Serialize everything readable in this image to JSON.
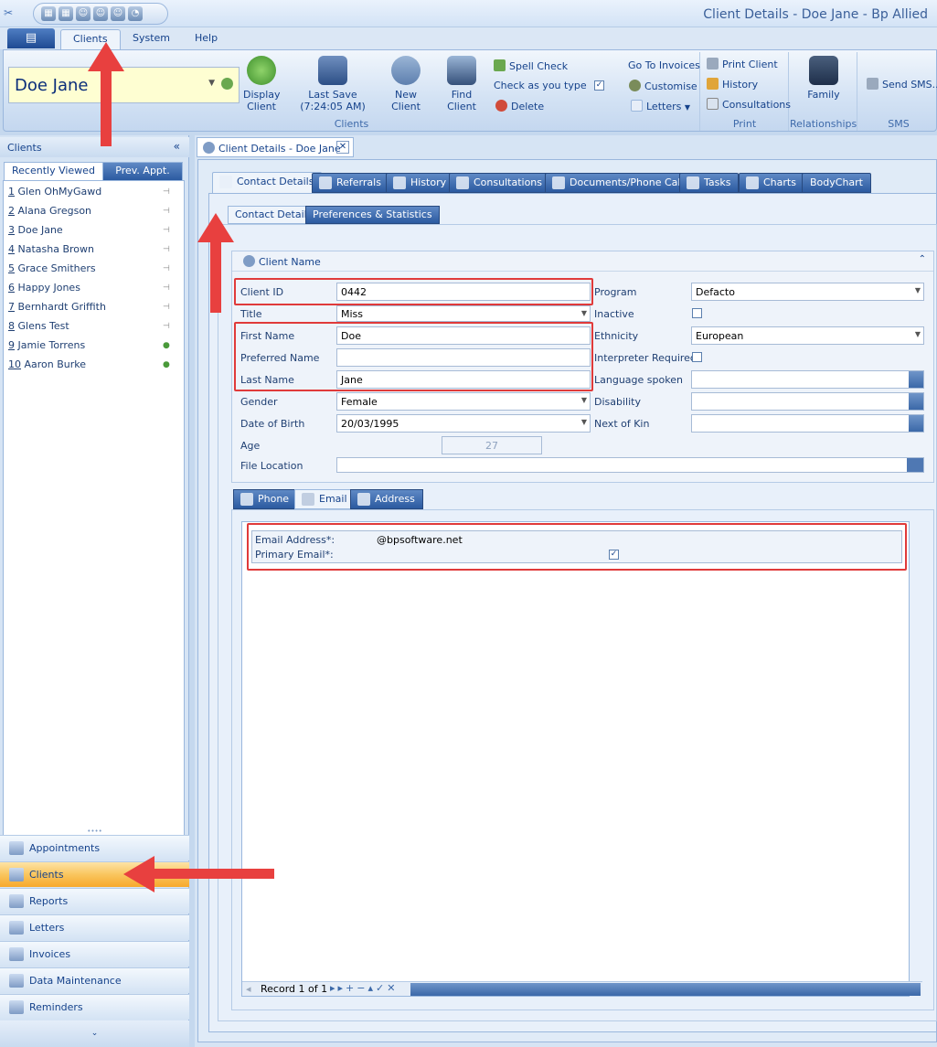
{
  "window": {
    "title": "Client Details - Doe Jane - Bp Allied"
  },
  "ribbon_tabs": [
    "Clients",
    "System",
    "Help"
  ],
  "client_selector": {
    "value": "Doe Jane"
  },
  "ribbon": {
    "display_client": "Display Client",
    "last_save": "Last Save",
    "last_save_time": "(7:24:05 AM)",
    "new_client": "New Client",
    "find_client": "Find Client",
    "spell_check": "Spell Check",
    "check_as_you_type": "Check as you type",
    "delete": "Delete",
    "go_to_invoices": "Go To Invoices",
    "customise": "Customise",
    "letters": "Letters",
    "print_client": "Print Client",
    "history": "History",
    "consultations": "Consultations",
    "family": "Family",
    "send_sms": "Send SMS...",
    "group_clients": "Clients",
    "group_print": "Print",
    "group_relationships": "Relationships",
    "group_sms": "SMS"
  },
  "left_panel": {
    "title": "Clients",
    "tabs": [
      "Recently Viewed",
      "Prev. Appt."
    ],
    "clients": [
      {
        "num": "1",
        "name": "Glen OhMyGawd"
      },
      {
        "num": "2",
        "name": "Alana Gregson"
      },
      {
        "num": "3",
        "name": "Doe Jane"
      },
      {
        "num": "4",
        "name": "Natasha Brown"
      },
      {
        "num": "5",
        "name": "Grace Smithers"
      },
      {
        "num": "6",
        "name": "Happy Jones"
      },
      {
        "num": "7",
        "name": "Bernhardt Griffith"
      },
      {
        "num": "8",
        "name": "Glens Test"
      },
      {
        "num": "9",
        "name": "Jamie Torrens"
      },
      {
        "num": "10",
        "name": "Aaron Burke"
      }
    ],
    "nav": [
      "Appointments",
      "Clients",
      "Reports",
      "Letters",
      "Invoices",
      "Data Maintenance",
      "Reminders"
    ]
  },
  "doc_tab": {
    "title": "Client Details - Doe Jane"
  },
  "content_tabs": [
    "Contact Details",
    "Referrals",
    "History",
    "Consultations",
    "Documents/Phone Calls",
    "Tasks",
    "Charts",
    "BodyChart"
  ],
  "sub_tabs": [
    "Contact Details",
    "Preferences & Statistics"
  ],
  "client_name_panel": {
    "title": "Client Name"
  },
  "form": {
    "client_id_label": "Client ID",
    "client_id": "0442",
    "title_label": "Title",
    "title": "Miss",
    "first_name_label": "First Name",
    "first_name": "Doe",
    "preferred_name_label": "Preferred Name",
    "preferred_name": "",
    "last_name_label": "Last Name",
    "last_name": "Jane",
    "gender_label": "Gender",
    "gender": "Female",
    "dob_label": "Date of Birth",
    "dob": "20/03/1995",
    "age_label": "Age",
    "age": "27",
    "file_location_label": "File Location",
    "file_location": "",
    "program_label": "Program",
    "program": "Defacto",
    "inactive_label": "Inactive",
    "ethnicity_label": "Ethnicity",
    "ethnicity": "European",
    "interpreter_label": "Interpreter Required",
    "language_label": "Language spoken",
    "language": "",
    "disability_label": "Disability",
    "disability": "",
    "next_of_kin_label": "Next of Kin",
    "next_of_kin": ""
  },
  "contact_tabs": [
    "Phone",
    "Email",
    "Address"
  ],
  "email": {
    "address_label": "Email Address*:",
    "address": "@bpsoftware.net",
    "primary_label": "Primary Email*:",
    "primary_checked": true
  },
  "record_nav": {
    "text": "Record 1 of 1"
  },
  "colors": {
    "ribbon_blue": "#15428b",
    "highlight_red": "#e03a3a",
    "client_field_yellow": "#fefed2",
    "active_nav_orange": "#f9c55e"
  }
}
